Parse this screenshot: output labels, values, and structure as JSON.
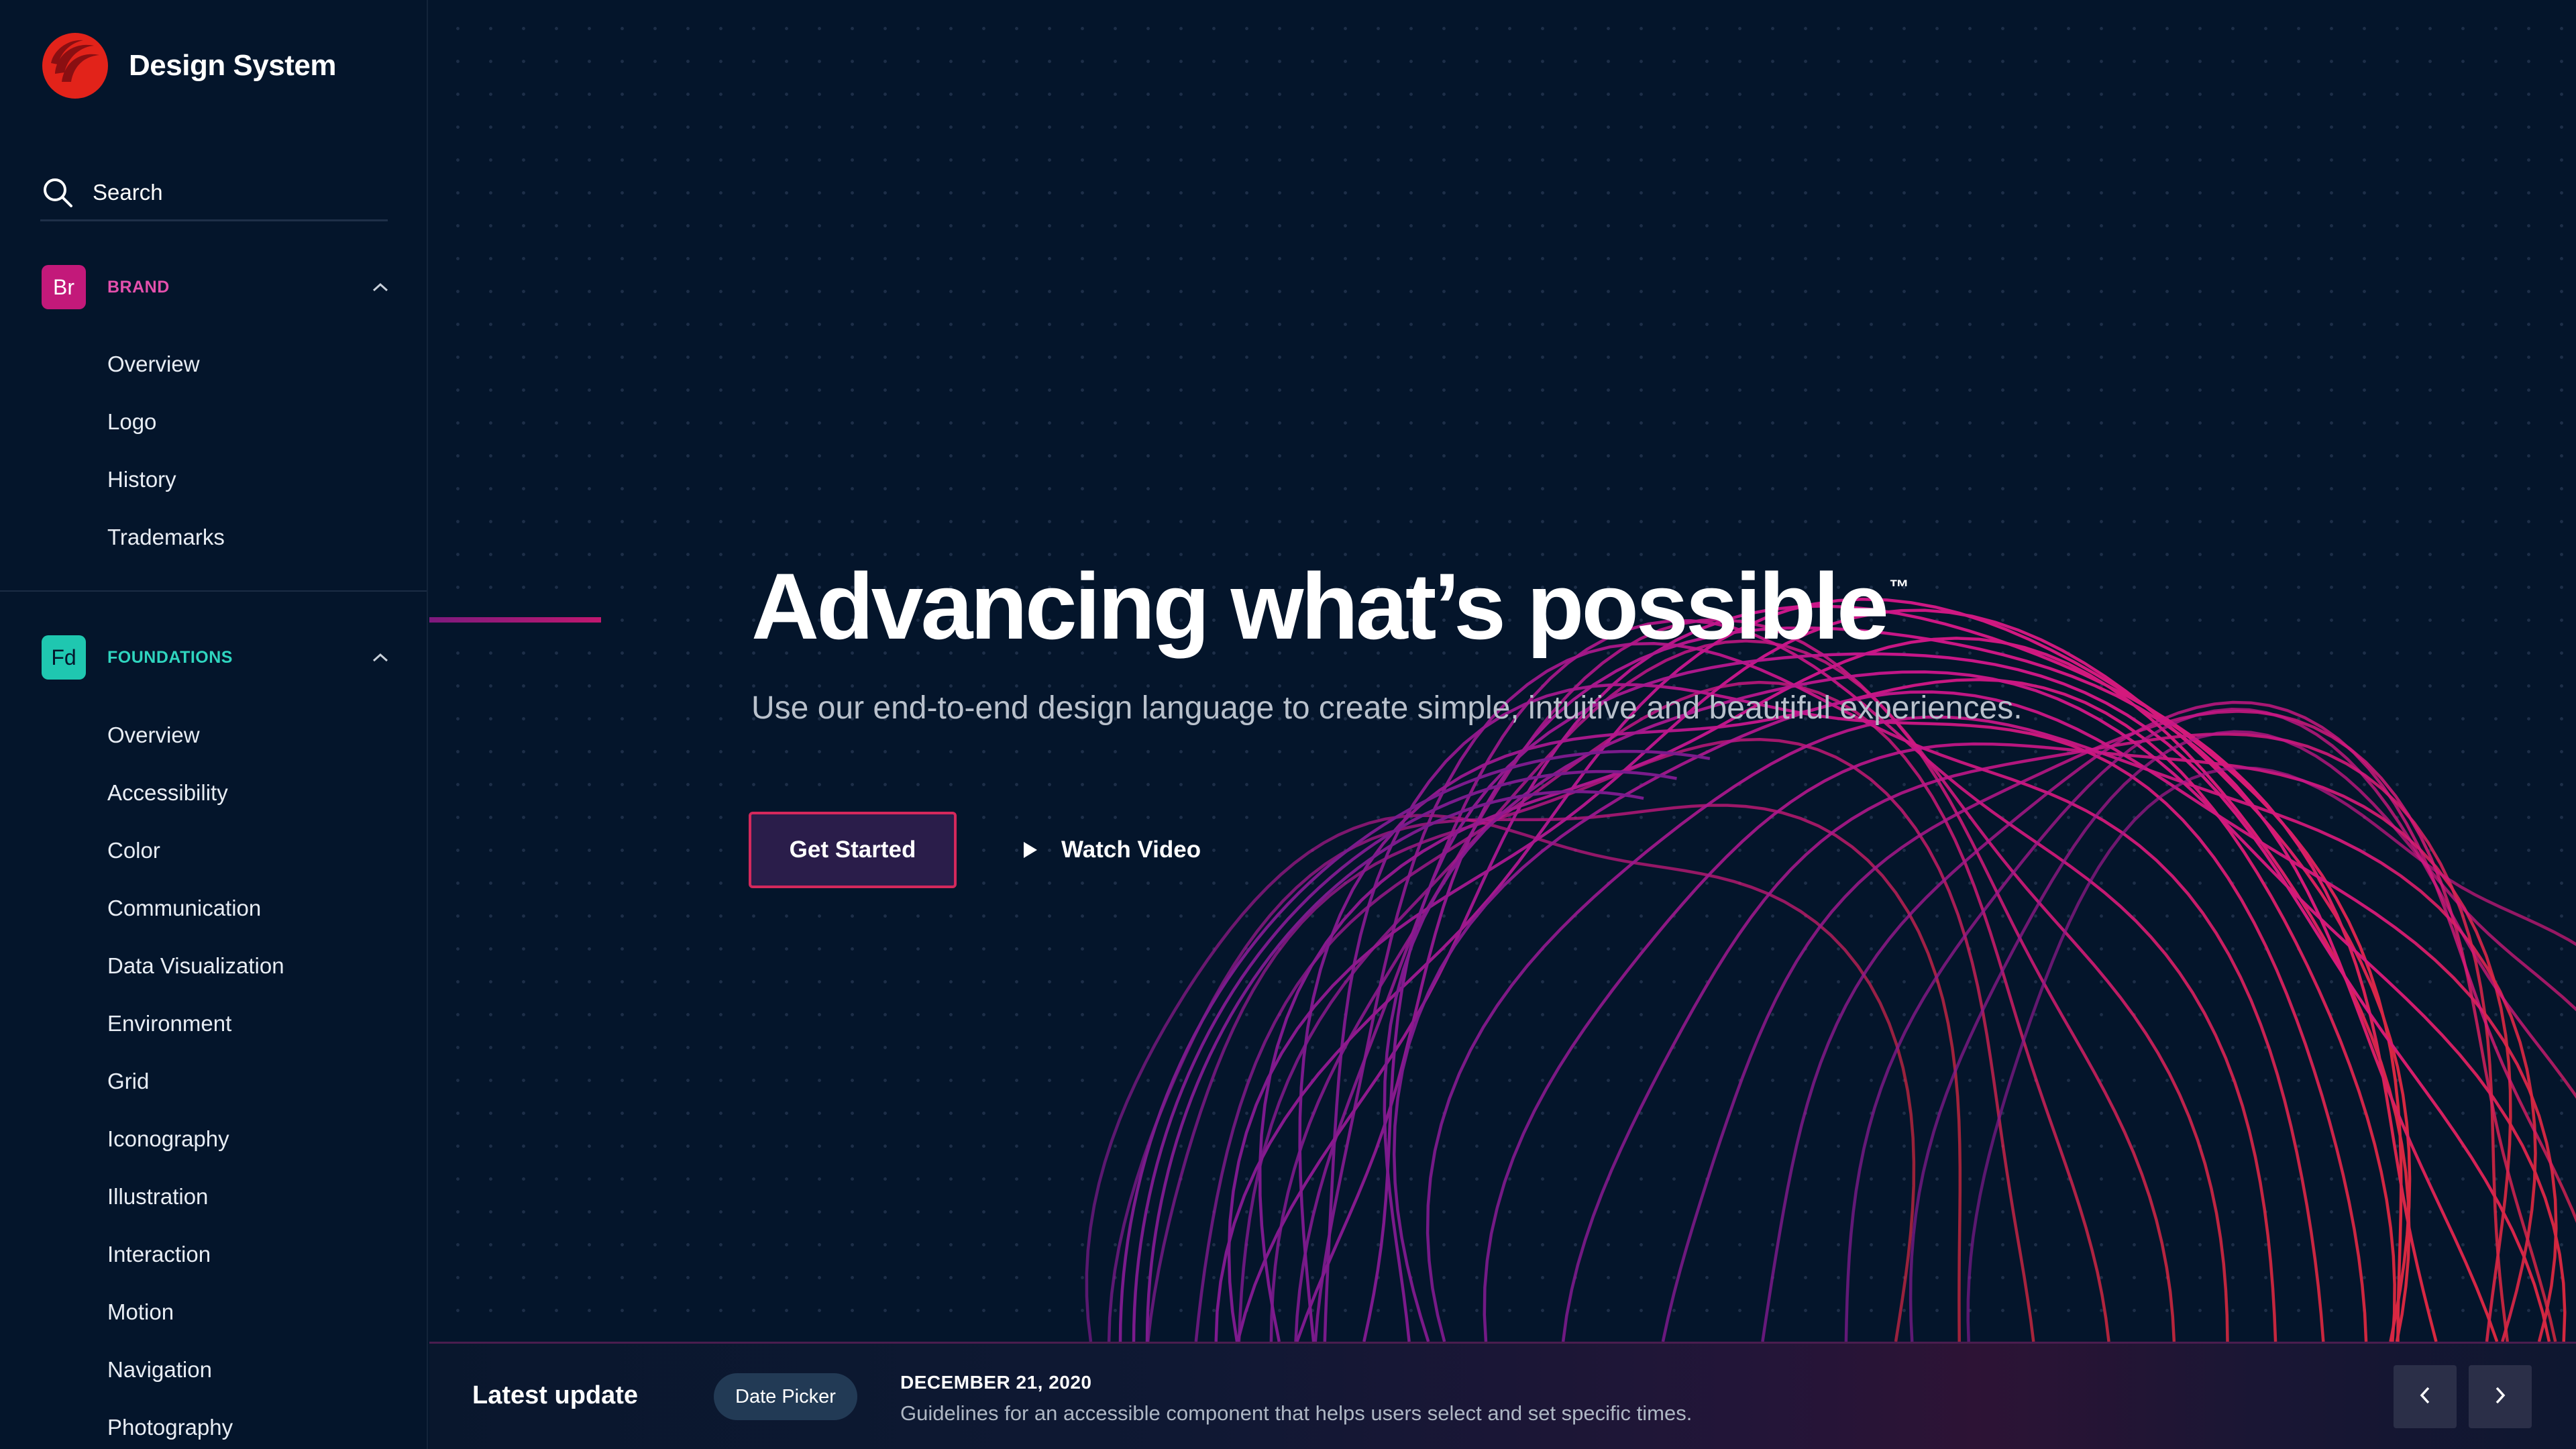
{
  "app": {
    "title": "Design System"
  },
  "search": {
    "placeholder": "Search"
  },
  "sidebar": {
    "sections": [
      {
        "badge": "Br",
        "label": "BRAND",
        "color": "#e450ad",
        "items": [
          "Overview",
          "Logo",
          "History",
          "Trademarks"
        ]
      },
      {
        "badge": "Fd",
        "label": "FOUNDATIONS",
        "color": "#2fd5bf",
        "items": [
          "Overview",
          "Accessibility",
          "Color",
          "Communication",
          "Data Visualization",
          "Environment",
          "Grid",
          "Iconography",
          "Illustration",
          "Interaction",
          "Motion",
          "Navigation",
          "Photography"
        ]
      }
    ]
  },
  "hero": {
    "title": "Advancing what’s possible",
    "trademark": "™",
    "subtitle": "Use our end-to-end design language to create simple, intuitive and beautiful experiences.",
    "primary_button": "Get Started",
    "video_button": "Watch Video"
  },
  "update": {
    "heading": "Latest update",
    "chip": "Date Picker",
    "date": "DECEMBER 21, 2020",
    "description": "Guidelines for an accessible component that helps users select and set specific times."
  },
  "icons": {
    "logo": "logo-icon",
    "search": "search-icon",
    "collapse": "chevron-up-icon",
    "play": "play-icon",
    "prev": "chevron-left-icon",
    "next": "chevron-right-icon"
  },
  "colors": {
    "background": "#04152b",
    "brand_accent": "#c3197a",
    "foundations_accent": "#1fc7b0",
    "primary_border": "#d4285c",
    "art_magenta": "#c8168a",
    "art_red": "#d8283f"
  }
}
